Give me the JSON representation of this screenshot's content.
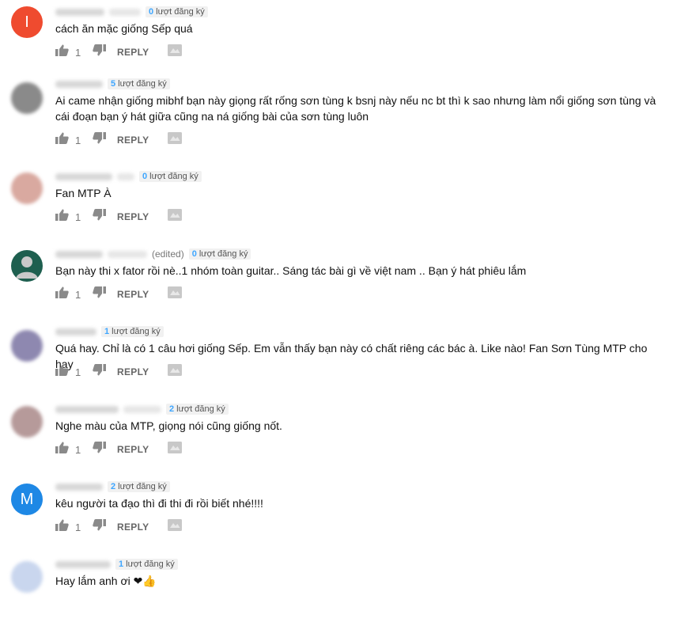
{
  "comments": [
    {
      "avatar_letter": "I",
      "avatar_color": "#ef4b2f",
      "blur_avatar": false,
      "edited": "",
      "subs": "0",
      "subs_label": "lượt đăng ký",
      "text": "cách ăn mặc giống Sếp quá",
      "likes": "1",
      "reply": "REPLY"
    },
    {
      "avatar_letter": "",
      "avatar_color": "#8a8a8a",
      "blur_avatar": true,
      "edited": "",
      "subs": "5",
      "subs_label": "lượt đăng ký",
      "text": "Ai came nhận giống mibhf bạn này giọng rất rống sơn tùng k bsnj này nếu nc bt thì k sao nhưng làm nổi giống sơn tùng và cái đoạn bạn ý hát giữa cũng na ná giống bài của sơn tùng luôn",
      "likes": "1",
      "reply": "REPLY"
    },
    {
      "avatar_letter": "",
      "avatar_color": "#d9a9a0",
      "blur_avatar": true,
      "edited": "",
      "subs": "0",
      "subs_label": "lượt đăng ký",
      "text": "Fan MTP À",
      "likes": "1",
      "reply": "REPLY"
    },
    {
      "avatar_letter": "",
      "avatar_color": "#1e5f4f",
      "blur_avatar": false,
      "edited": "(edited)",
      "subs": "0",
      "subs_label": "lượt đăng ký",
      "text": "Bạn này thi x fator rồi nè..1 nhóm toàn guitar.. Sáng tác bài gì về việt nam .. Bạn ý hát phiêu lắm",
      "likes": "1",
      "reply": "REPLY"
    },
    {
      "avatar_letter": "",
      "avatar_color": "#8e88b0",
      "blur_avatar": true,
      "edited": "",
      "subs": "1",
      "subs_label": "lượt đăng ký",
      "text": "Quá hay. Chỉ là có 1 câu hơi giống Sếp. Em vẫn thấy bạn này có chất riêng các bác à. Like nào! Fan Sơn Tùng MTP cho hay",
      "likes": "1",
      "reply": "REPLY"
    },
    {
      "avatar_letter": "",
      "avatar_color": "#b69a9a",
      "blur_avatar": true,
      "edited": "",
      "subs": "2",
      "subs_label": "lượt đăng ký",
      "text": "Nghe màu của MTP, giọng nói cũng giống nốt.",
      "likes": "1",
      "reply": "REPLY"
    },
    {
      "avatar_letter": "M",
      "avatar_color": "#1e88e5",
      "blur_avatar": false,
      "edited": "",
      "subs": "2",
      "subs_label": "lượt đăng ký",
      "text": "kêu người ta đạo thì đi thi đi rồi biết nhé!!!!",
      "likes": "1",
      "reply": "REPLY"
    },
    {
      "avatar_letter": "",
      "avatar_color": "#c9d6ee",
      "blur_avatar": true,
      "edited": "",
      "subs": "1",
      "subs_label": "lượt đăng ký",
      "text": "Hay lắm anh ơi ❤👍",
      "likes": "",
      "reply": ""
    }
  ]
}
